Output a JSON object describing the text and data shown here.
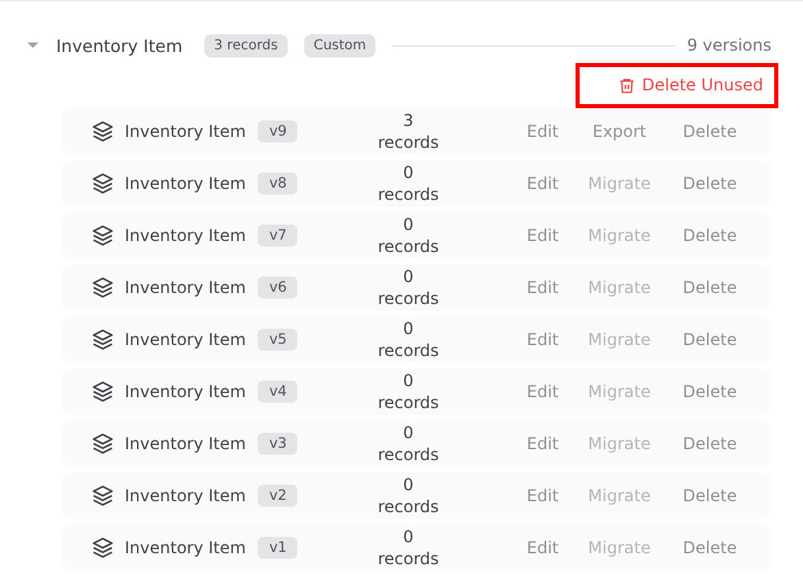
{
  "group": {
    "title": "Inventory Item",
    "expanded": true,
    "badges": [
      "3 records",
      "Custom"
    ],
    "version_count": "9 versions",
    "delete_unused": {
      "label": "Delete Unused",
      "highlighted": true
    }
  },
  "versions": [
    {
      "name": "Inventory Item",
      "version": "v9",
      "count": "3",
      "unit": "records",
      "actions": [
        {
          "label": "Edit",
          "disabled": false
        },
        {
          "label": "Export",
          "disabled": false
        },
        {
          "label": "Delete",
          "disabled": false
        }
      ]
    },
    {
      "name": "Inventory Item",
      "version": "v8",
      "count": "0",
      "unit": "records",
      "actions": [
        {
          "label": "Edit",
          "disabled": false
        },
        {
          "label": "Migrate",
          "disabled": true
        },
        {
          "label": "Delete",
          "disabled": false
        }
      ]
    },
    {
      "name": "Inventory Item",
      "version": "v7",
      "count": "0",
      "unit": "records",
      "actions": [
        {
          "label": "Edit",
          "disabled": false
        },
        {
          "label": "Migrate",
          "disabled": true
        },
        {
          "label": "Delete",
          "disabled": false
        }
      ]
    },
    {
      "name": "Inventory Item",
      "version": "v6",
      "count": "0",
      "unit": "records",
      "actions": [
        {
          "label": "Edit",
          "disabled": false
        },
        {
          "label": "Migrate",
          "disabled": true
        },
        {
          "label": "Delete",
          "disabled": false
        }
      ]
    },
    {
      "name": "Inventory Item",
      "version": "v5",
      "count": "0",
      "unit": "records",
      "actions": [
        {
          "label": "Edit",
          "disabled": false
        },
        {
          "label": "Migrate",
          "disabled": true
        },
        {
          "label": "Delete",
          "disabled": false
        }
      ]
    },
    {
      "name": "Inventory Item",
      "version": "v4",
      "count": "0",
      "unit": "records",
      "actions": [
        {
          "label": "Edit",
          "disabled": false
        },
        {
          "label": "Migrate",
          "disabled": true
        },
        {
          "label": "Delete",
          "disabled": false
        }
      ]
    },
    {
      "name": "Inventory Item",
      "version": "v3",
      "count": "0",
      "unit": "records",
      "actions": [
        {
          "label": "Edit",
          "disabled": false
        },
        {
          "label": "Migrate",
          "disabled": true
        },
        {
          "label": "Delete",
          "disabled": false
        }
      ]
    },
    {
      "name": "Inventory Item",
      "version": "v2",
      "count": "0",
      "unit": "records",
      "actions": [
        {
          "label": "Edit",
          "disabled": false
        },
        {
          "label": "Migrate",
          "disabled": true
        },
        {
          "label": "Delete",
          "disabled": false
        }
      ]
    },
    {
      "name": "Inventory Item",
      "version": "v1",
      "count": "0",
      "unit": "records",
      "actions": [
        {
          "label": "Edit",
          "disabled": false
        },
        {
          "label": "Migrate",
          "disabled": true
        },
        {
          "label": "Delete",
          "disabled": false
        }
      ]
    }
  ]
}
